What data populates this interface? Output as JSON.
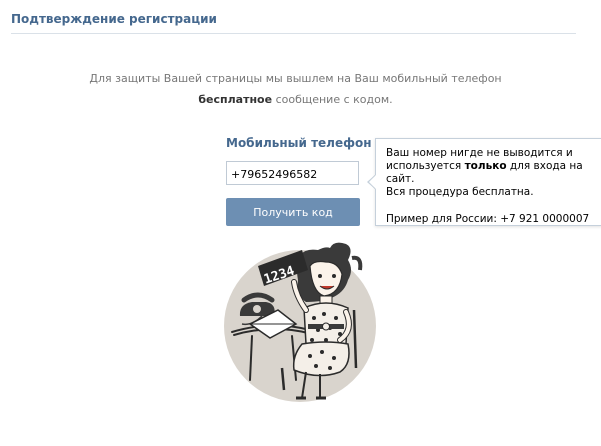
{
  "header": {
    "title": "Подтверждение регистрации"
  },
  "intro": {
    "line1": "Для защиты Вашей страницы мы вышлем на Ваш мобильный телефон",
    "line2_bold": "бесплатное",
    "line2_rest": " сообщение с кодом."
  },
  "form": {
    "phone_label": "Мобильный телефон",
    "phone_value": "+79652496582",
    "submit_label": "Получить код"
  },
  "tooltip": {
    "text_before": "Ваш номер нигде не выводится и используется ",
    "text_bold": "только",
    "text_after": " для входа на сайт.",
    "line2": "Вся процедура бесплатна.",
    "example": "Пример для России: +7 921 0000007"
  },
  "illustration": {
    "sign_text": "1234"
  },
  "colors": {
    "brand_blue": "#45688e",
    "button_blue": "#6d8fb3",
    "muted_text": "#777777"
  }
}
